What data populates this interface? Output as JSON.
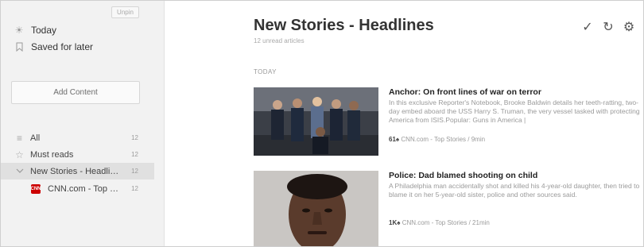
{
  "sidebar": {
    "unpin_label": "Unpin",
    "nav": [
      {
        "label": "Today",
        "icon": "sun-icon"
      },
      {
        "label": "Saved for later",
        "icon": "bookmark-icon"
      }
    ],
    "add_content_label": "Add Content",
    "feeds": [
      {
        "label": "All",
        "count": "12",
        "icon": "list-icon"
      },
      {
        "label": "Must reads",
        "count": "12",
        "icon": "star-icon"
      },
      {
        "label": "New Stories - Headlines",
        "count": "12",
        "icon": "chevron-down-icon"
      },
      {
        "label": "CNN.com - Top Sto...",
        "count": "12",
        "icon": "cnn-logo"
      }
    ],
    "cnn_logo_text": "CNN"
  },
  "main": {
    "title": "New Stories - Headlines",
    "subtitle": "12 unread articles",
    "section": "TODAY",
    "actions": {
      "check": "✓",
      "refresh": "↻",
      "settings": "⚙"
    },
    "articles": [
      {
        "title": "Anchor: On front lines of war on terror",
        "body": "In this exclusive Reporter's Notebook, Brooke Baldwin details her teeth-ratting, two-day embed aboard the USS Harry S. Truman, the very vessel tasked with protecting America from ISIS.Popular: Guns in America |",
        "engagement": "61♠",
        "meta": "CNN.com - Top Stories / 9min"
      },
      {
        "title": "Police: Dad blamed shooting on child",
        "body": "A Philadelphia man accidentally shot and killed his 4-year-old daughter, then tried to blame it on her 5-year-old sister, police and other sources said.",
        "engagement": "1K♠",
        "meta": "CNN.com - Top Stories / 21min"
      }
    ]
  },
  "colors": {
    "sidebar_bg": "#f2f2f2",
    "selected_bg": "#e0e0e0",
    "cnn_red": "#cc0000"
  }
}
